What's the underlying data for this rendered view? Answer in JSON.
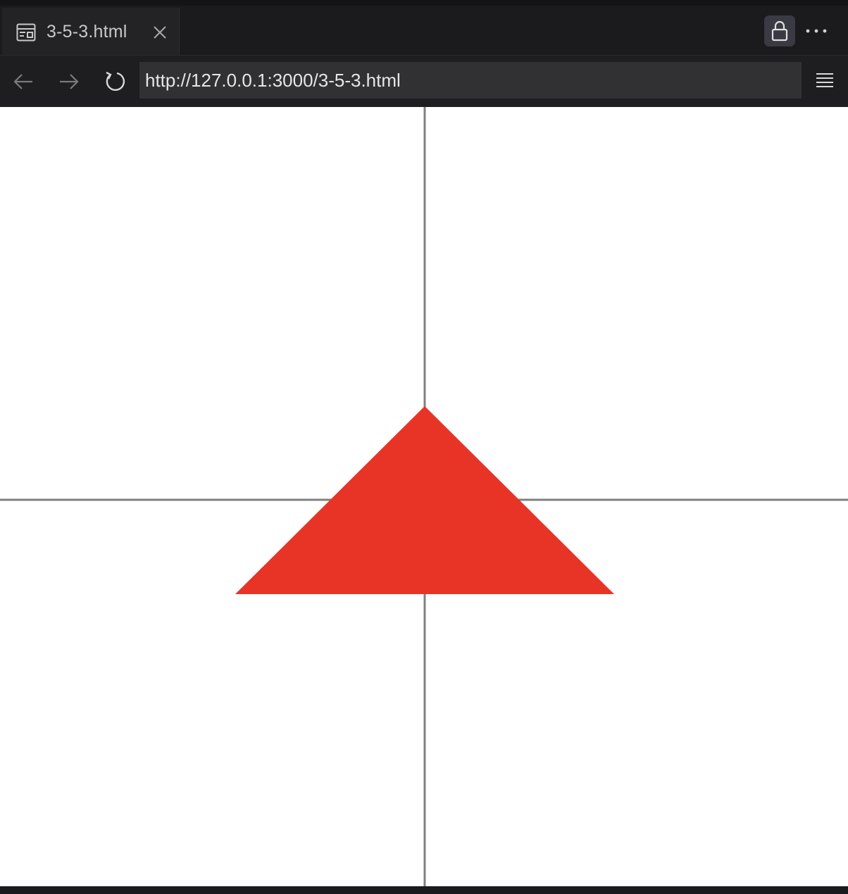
{
  "tab": {
    "title": "3-5-3.html",
    "icon": "page-preview-icon"
  },
  "toolbar": {
    "lock_icon": "lock-icon",
    "more_icon": "more-horizontal-icon",
    "back_icon": "arrow-left-icon",
    "forward_icon": "arrow-right-icon",
    "reload_icon": "reload-icon",
    "menu_icon": "hamburger-menu-icon"
  },
  "address": {
    "url": "http://127.0.0.1:3000/3-5-3.html"
  },
  "canvas": {
    "axis_color": "#808080",
    "shape": "triangle",
    "shape_color": "#e83426"
  }
}
